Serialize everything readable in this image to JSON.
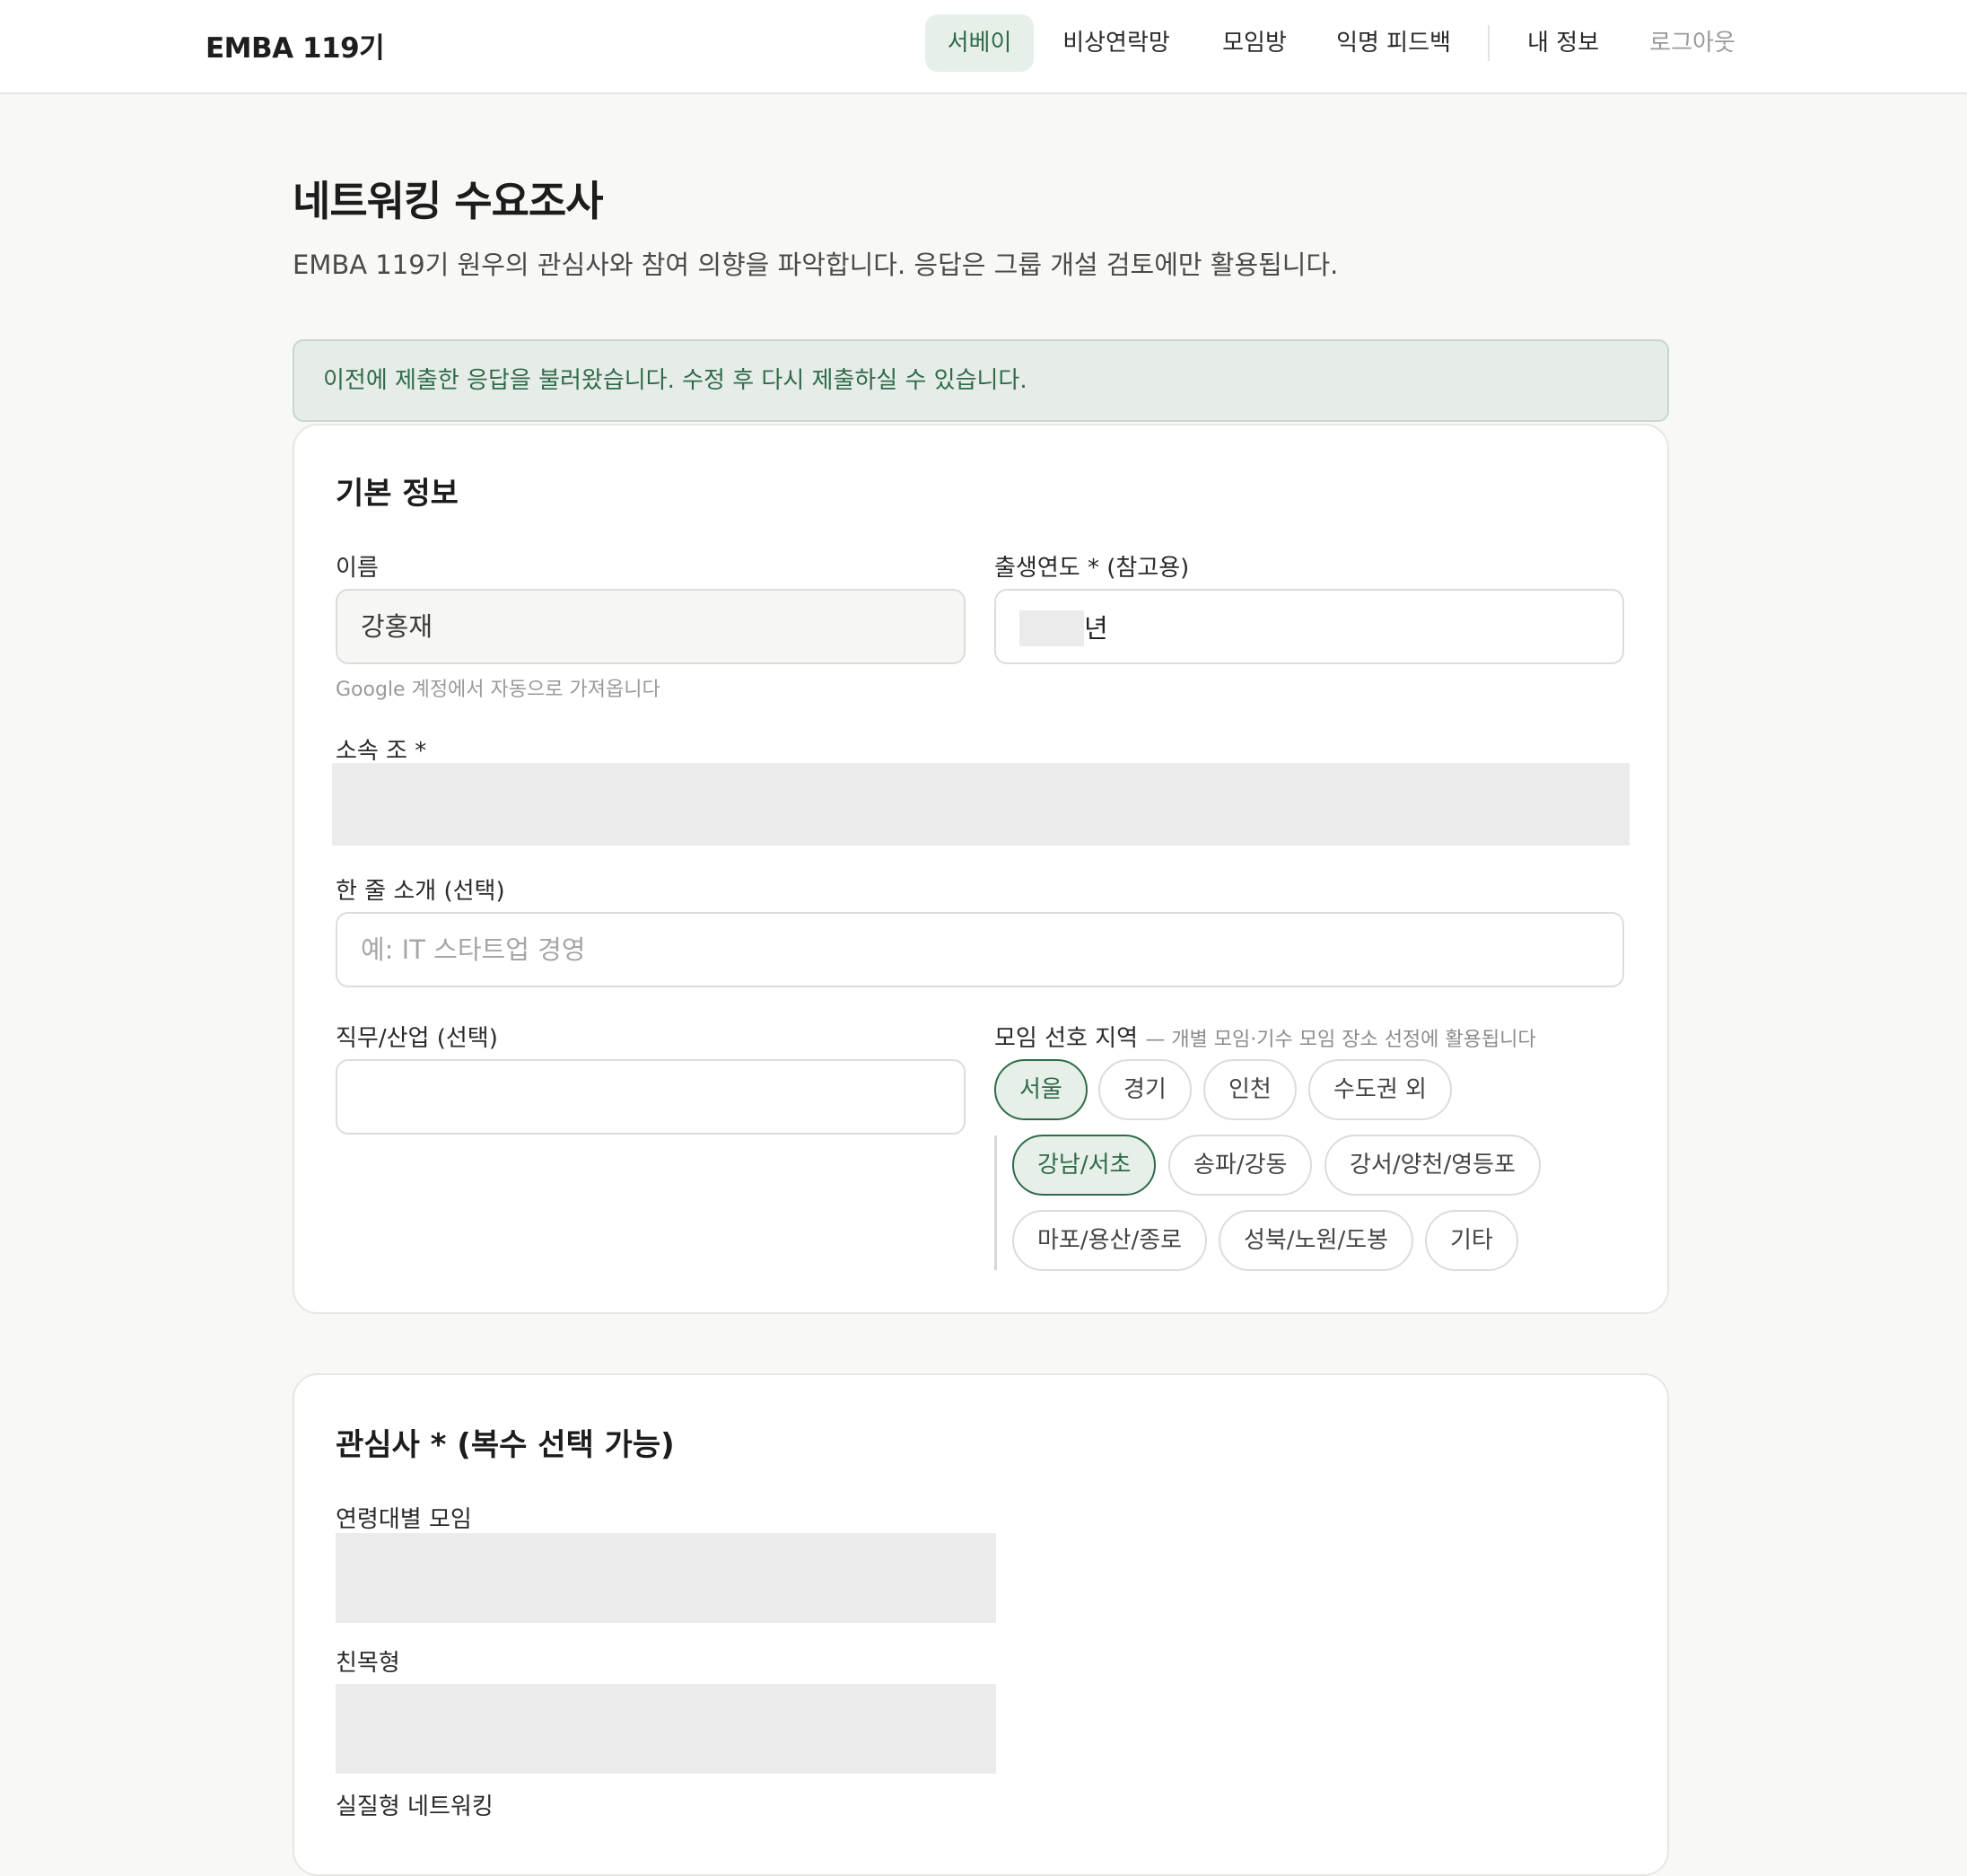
{
  "nav": {
    "brand": "EMBA 119기",
    "items": [
      "서베이",
      "비상연락망",
      "모임방",
      "익명 피드백",
      "내 정보",
      "로그아웃"
    ]
  },
  "page": {
    "title": "네트워킹 수요조사",
    "subtitle": "EMBA 119기 원우의 관심사와 참여 의향을 파악합니다. 응답은 그룹 개설 검토에만 활용됩니다.",
    "notice": "이전에 제출한 응답을 불러왔습니다. 수정 후 다시 제출하실 수 있습니다."
  },
  "basic": {
    "title": "기본 정보",
    "name_label": "이름",
    "name_value": "강홍재",
    "name_helper": "Google 계정에서 자동으로 가져옵니다",
    "birth_label": "출생연도 * (참고용)",
    "birth_suffix": "년",
    "team_label": "소속 조 *",
    "intro_label": "한 줄 소개 (선택)",
    "intro_placeholder": "예: IT 스타트업 경영",
    "job_label": "직무/산업 (선택)",
    "region_label": "모임 선호 지역",
    "region_hint": "— 개별 모임·기수 모임 장소 선정에 활용됩니다",
    "regions": [
      "서울",
      "경기",
      "인천",
      "수도권 외"
    ],
    "subregions": [
      "강남/서초",
      "송파/강동",
      "강서/양천/영등포",
      "마포/용산/종로",
      "성북/노원/도봉",
      "기타"
    ]
  },
  "interests": {
    "title": "관심사 * (복수 선택 가능)",
    "groups": [
      "연령대별 모임",
      "친목형",
      "실질형 네트워킹"
    ]
  }
}
